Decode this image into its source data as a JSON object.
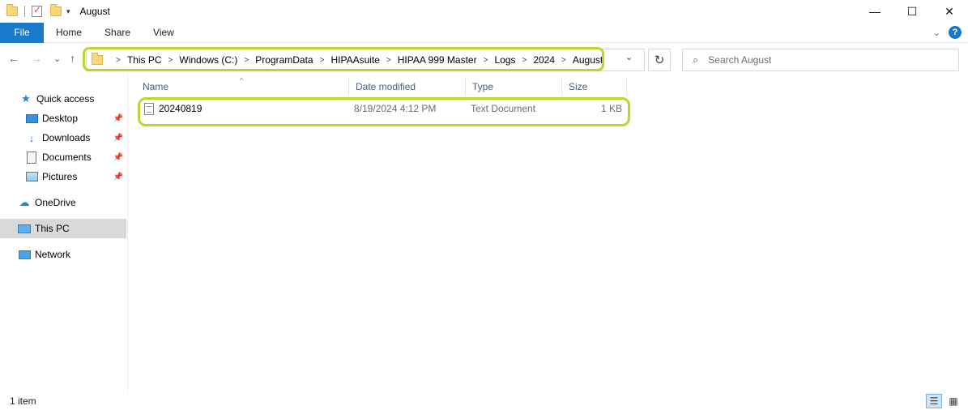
{
  "window": {
    "title": "August",
    "controls": {
      "minimize": "—",
      "maximize": "☐",
      "close": "✕"
    }
  },
  "ribbon": {
    "tabs": [
      {
        "label": "File"
      },
      {
        "label": "Home"
      },
      {
        "label": "Share"
      },
      {
        "label": "View"
      }
    ],
    "expand_glyph": "⌄",
    "help_glyph": "?"
  },
  "nav": {
    "back_glyph": "←",
    "forward_glyph": "→",
    "recent_glyph": "⌄",
    "up_glyph": "↑",
    "breadcrumb": [
      "This PC",
      "Windows (C:)",
      "ProgramData",
      "HIPAAsuite",
      "HIPAA 999 Master",
      "Logs",
      "2024",
      "August"
    ],
    "crumb_separator": ">",
    "refresh_glyph": "↻",
    "search_placeholder": "Search August"
  },
  "sidebar": {
    "items": [
      {
        "label": "Quick access",
        "icon": "star-icon"
      },
      {
        "label": "Desktop",
        "icon": "desktop-icon",
        "pinned": true
      },
      {
        "label": "Downloads",
        "icon": "downloads-icon",
        "pinned": true
      },
      {
        "label": "Documents",
        "icon": "documents-icon",
        "pinned": true
      },
      {
        "label": "Pictures",
        "icon": "pictures-icon",
        "pinned": true
      },
      {
        "label": "OneDrive",
        "icon": "cloud-icon"
      },
      {
        "label": "This PC",
        "icon": "computer-icon",
        "selected": true
      },
      {
        "label": "Network",
        "icon": "network-icon"
      }
    ],
    "pin_glyph": "📌"
  },
  "filelist": {
    "columns": [
      "Name",
      "Date modified",
      "Type",
      "Size"
    ],
    "sort_glyph": "^",
    "rows": [
      {
        "name": "20240819",
        "date": "8/19/2024 4:12 PM",
        "type": "Text Document",
        "size": "1 KB"
      }
    ]
  },
  "status": {
    "item_count": "1 item"
  },
  "colors": {
    "accent": "#1979ca",
    "highlight": "#b5d92e",
    "selected_bg": "#d9d9d9"
  }
}
